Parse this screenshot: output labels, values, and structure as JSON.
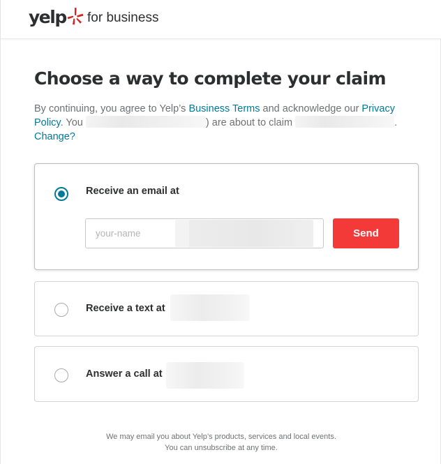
{
  "header": {
    "logo_text": "yelp",
    "subtitle": "for business",
    "brand_color": "#d32323"
  },
  "title": "Choose a way to complete your claim",
  "intro": {
    "prefix": "By continuing, you agree to Yelp’s ",
    "business_terms": "Business Terms",
    "middle": " and acknowledge our ",
    "privacy_policy": "Privacy Policy",
    "after_policy": ". You ",
    "claim_text": ") are about to claim ",
    "period": ".",
    "change_link": "Change?"
  },
  "options": {
    "email": {
      "label": "Receive an email at",
      "selected": true,
      "placeholder": "your-name",
      "send_label": "Send"
    },
    "text": {
      "label": "Receive a text at",
      "selected": false
    },
    "call": {
      "label": "Answer a call at",
      "selected": false
    }
  },
  "footer": {
    "line1": "We may email you about Yelp’s products, services and local events.",
    "line2": "You can unsubscribe at any time."
  },
  "colors": {
    "accent": "#027a97",
    "send_button": "#f43939",
    "heading": "#2d2e2f"
  },
  "icons": {
    "logo_burst": "yelp-burst-icon",
    "radio_selected": "radio-selected-icon",
    "radio_unselected": "radio-unselected-icon"
  }
}
